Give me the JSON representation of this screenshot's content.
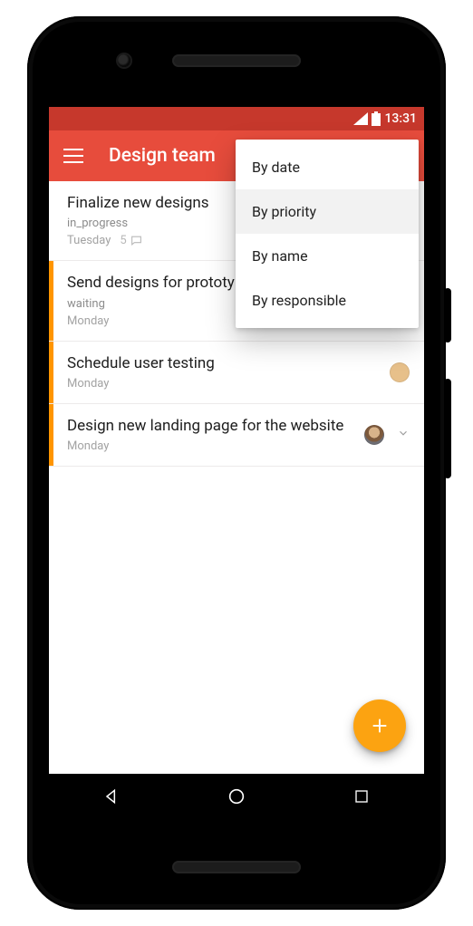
{
  "status": {
    "time": "13:31"
  },
  "appbar": {
    "title": "Design team"
  },
  "menu": {
    "options": [
      {
        "label": "By date",
        "selected": false
      },
      {
        "label": "By priority",
        "selected": true
      },
      {
        "label": "By name",
        "selected": false
      },
      {
        "label": "By responsible",
        "selected": false
      }
    ]
  },
  "tasks": [
    {
      "title": "Finalize new designs",
      "status": "in_progress",
      "day": "Tuesday",
      "comments": "5",
      "priority_bar": false,
      "avatar": null,
      "expand": false
    },
    {
      "title": "Send designs for prototyping",
      "status": "waiting",
      "day": "Monday",
      "comments": null,
      "priority_bar": true,
      "avatar": null,
      "expand": false
    },
    {
      "title": "Schedule user testing",
      "status": null,
      "day": "Monday",
      "comments": null,
      "priority_bar": true,
      "avatar": "a1",
      "expand": false
    },
    {
      "title": "Design new landing page for the website",
      "status": null,
      "day": "Monday",
      "comments": null,
      "priority_bar": true,
      "avatar": "a2",
      "expand": true
    }
  ],
  "colors": {
    "statusbar": "#c6382c",
    "appbar": "#e74c3c",
    "priority": "#ff9500",
    "fab": "#fca311"
  }
}
